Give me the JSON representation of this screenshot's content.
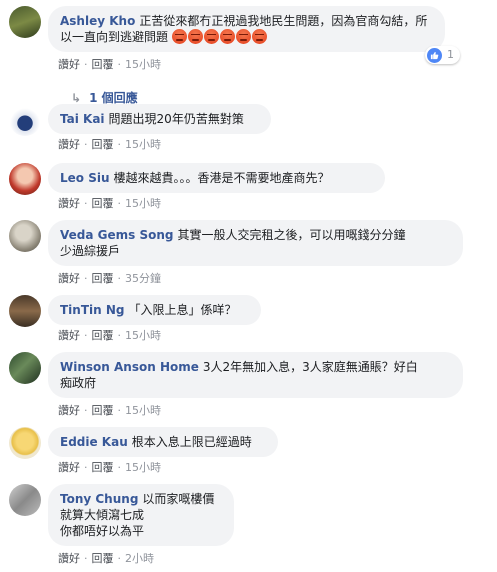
{
  "comments": [
    {
      "author": "Ashley Kho",
      "text": "正苦從來都冇正視過我地民生問題，因為官商勾結，所以一直向到逃避問題",
      "emojis": [
        "angry-emoji",
        "angry-emoji",
        "angry-emoji",
        "angry-emoji",
        "angry-emoji",
        "angry-emoji"
      ],
      "like": "讚好",
      "reply": "回覆",
      "time": "15小時",
      "like_count": "1",
      "replies_label": "1 個回應"
    },
    {
      "author": "Tai Kai",
      "text": "問題出現20年仍苦無對策",
      "like": "讚好",
      "reply": "回覆",
      "time": "15小時"
    },
    {
      "author": "Leo Siu",
      "text": "樓越來越貴。。。香港是不需要地產商先？",
      "like": "讚好",
      "reply": "回覆",
      "time": "15小時"
    },
    {
      "author": "Veda Gems Song",
      "text_line1": "其實一般人交完租之後，可以用嘅錢分分鐘",
      "text_line2": "少過綜援戶",
      "like": "讚好",
      "reply": "回覆",
      "time": "35分鐘"
    },
    {
      "author": "TinTin Ng",
      "text": "「入限上息」係咩？",
      "like": "讚好",
      "reply": "回覆",
      "time": "15小時"
    },
    {
      "author": "Winson Anson Home",
      "text_line1": "3人2年無加入息，3人家庭無通賬？好白",
      "text_line2": "痴政府",
      "like": "讚好",
      "reply": "回覆",
      "time": "15小時"
    },
    {
      "author": "Eddie Kau",
      "text": "根本入息上限已經過時",
      "like": "讚好",
      "reply": "回覆",
      "time": "15小時"
    },
    {
      "author": "Tony Chung",
      "text_line1": "以而家嘅樓價",
      "text_line2": "就算大傾瀉七成",
      "text_line3": "你都唔好以為平",
      "like": "讚好",
      "reply": "回覆",
      "time": "2小時"
    }
  ],
  "colors": {
    "author": "#385898",
    "bubble": "#f2f3f5",
    "meta": "#90949c",
    "like_blue": "#4f87f6"
  }
}
